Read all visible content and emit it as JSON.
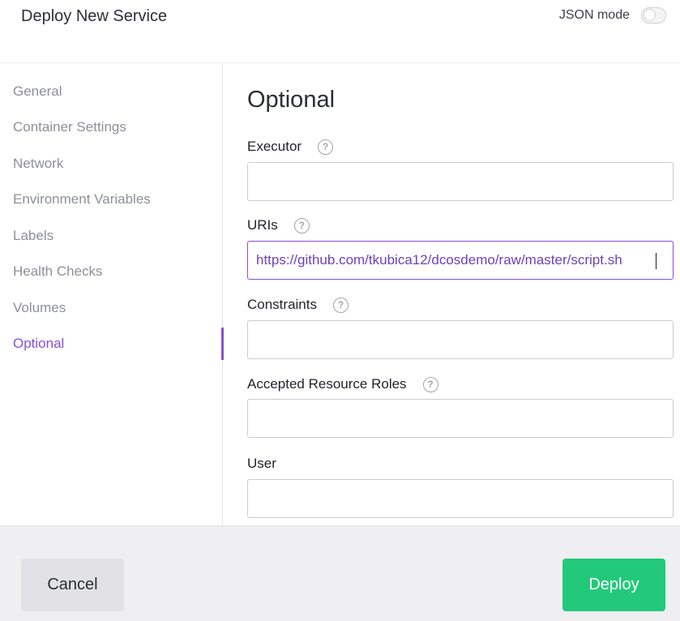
{
  "header": {
    "title": "Deploy New Service",
    "json_mode_label": "JSON mode",
    "json_mode_on": false
  },
  "sidebar": {
    "items": [
      {
        "label": "General"
      },
      {
        "label": "Container Settings"
      },
      {
        "label": "Network"
      },
      {
        "label": "Environment Variables"
      },
      {
        "label": "Labels"
      },
      {
        "label": "Health Checks"
      },
      {
        "label": "Volumes"
      },
      {
        "label": "Optional"
      }
    ],
    "active": "Optional"
  },
  "main": {
    "section_title": "Optional",
    "fields": [
      {
        "label": "Executor",
        "value": "",
        "has_help": true
      },
      {
        "label": "URIs",
        "value": "https://github.com/tkubica12/dcosdemo/raw/master/script.sh",
        "has_help": true,
        "focused": true
      },
      {
        "label": "Constraints",
        "value": "",
        "has_help": true
      },
      {
        "label": "Accepted Resource Roles",
        "value": "",
        "has_help": true
      },
      {
        "label": "User",
        "value": "",
        "has_help": false
      }
    ],
    "help_glyph": "?"
  },
  "footer": {
    "cancel_label": "Cancel",
    "deploy_label": "Deploy"
  },
  "colors": {
    "accent": "#8a4fd6",
    "deploy": "#23c97a"
  }
}
